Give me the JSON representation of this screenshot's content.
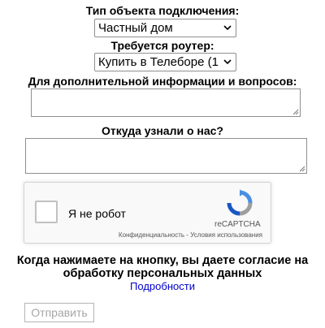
{
  "connection_type": {
    "label": "Тип объекта подключения:",
    "selected": "Частный дом"
  },
  "router": {
    "label": "Требуется роутер:",
    "selected": "Купить в Телеборе (1"
  },
  "additional_info": {
    "label": "Для дополнительной информации и вопросов:",
    "value": ""
  },
  "source": {
    "label": "Откуда узнали о нас?",
    "value": ""
  },
  "captcha": {
    "checkbox_label": "Я не робот",
    "brand": "reCAPTCHA",
    "privacy": "Конфиденциальность",
    "separator": "-",
    "terms": "Условия использования",
    "accent_color": "#4a90e2"
  },
  "consent": {
    "line1": "Когда нажимаете на кнопку, вы даете согласие на",
    "line2": "обработку персональных данных",
    "details_link": "Подробности",
    "link_color": "#0000cc"
  },
  "submit": {
    "label": "Отправить"
  }
}
